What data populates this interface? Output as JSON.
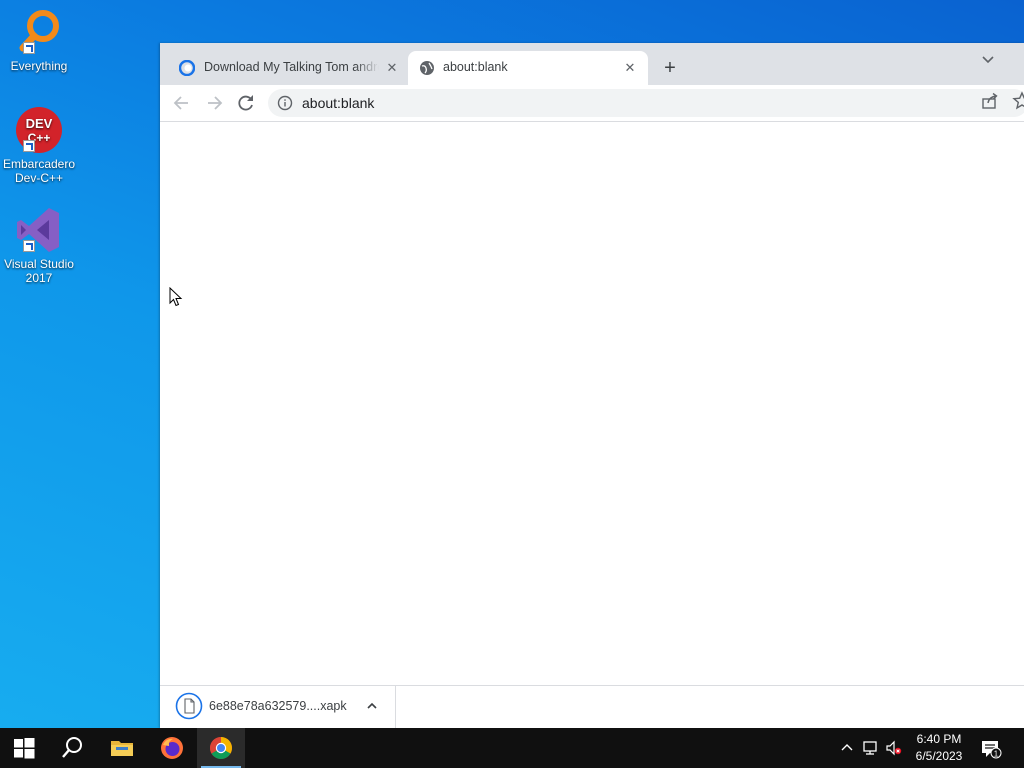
{
  "desktop": {
    "icons": [
      {
        "label": "Everything",
        "icon": "everything-search-icon"
      },
      {
        "label": "Embarcadero Dev-C++",
        "icon": "devcpp-icon",
        "badge_text": "DEV C++"
      },
      {
        "label": "Visual Studio 2017",
        "icon": "visual-studio-icon"
      }
    ]
  },
  "browser": {
    "tabs": [
      {
        "title": "Download My Talking Tom android",
        "favicon": "apkcombo-favicon",
        "active": false
      },
      {
        "title": "about:blank",
        "favicon": "globe-icon",
        "active": true
      }
    ],
    "new_tab_symbol": "+",
    "close_symbol": "✕",
    "omnibox": {
      "url": "about:blank"
    },
    "download": {
      "filename": "6e88e78a632579....xapk"
    }
  },
  "taskbar": {
    "apps": [
      "start",
      "search",
      "file-explorer",
      "firefox",
      "chrome"
    ],
    "active_app": "chrome",
    "clock": {
      "time": "6:40 PM",
      "date": "6/5/2023"
    },
    "notification_count": "1"
  },
  "colors": {
    "desktop_accent": "#0f97ea",
    "tabstrip": "#dee1e6",
    "omnibox": "#f1f3f4",
    "taskbar": "#101010",
    "active_underline": "#76b9ed"
  }
}
